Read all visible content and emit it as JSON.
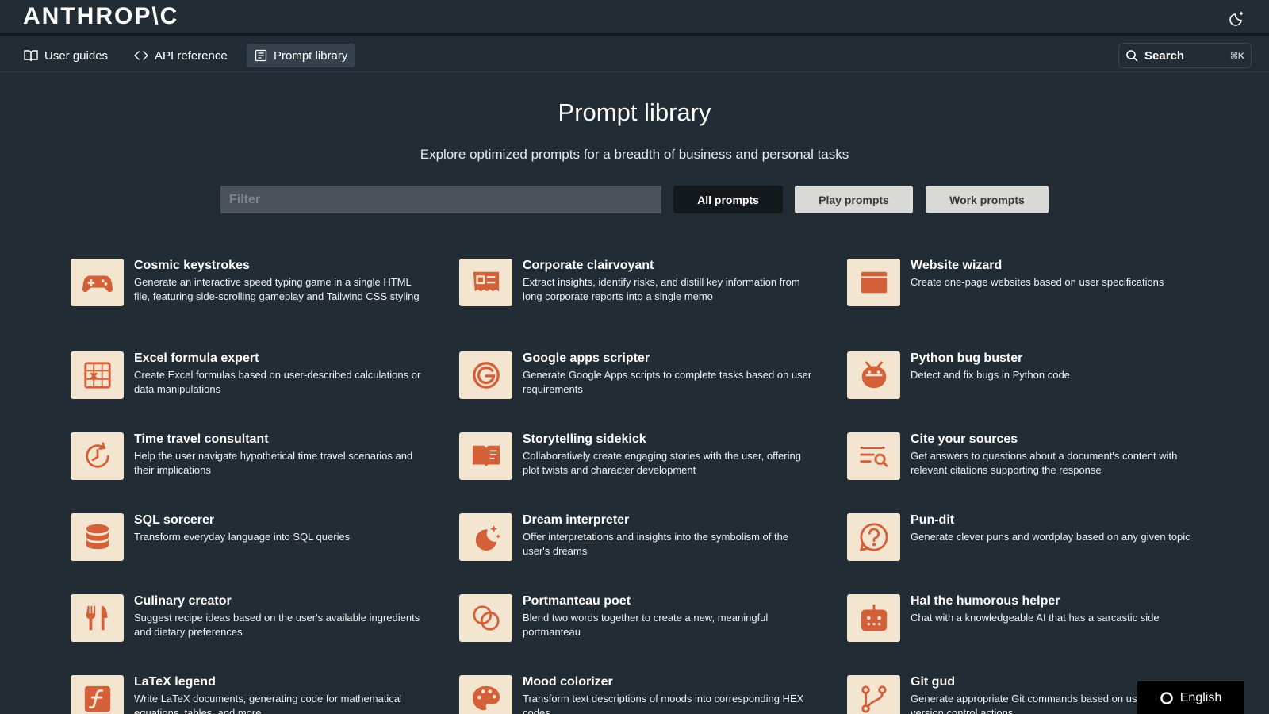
{
  "header": {
    "logo": "ANTHROP\\C",
    "theme_toggle_icon": "moon-sparkle-icon"
  },
  "nav": {
    "items": [
      {
        "label": "User guides",
        "icon": "book-icon"
      },
      {
        "label": "API reference",
        "icon": "code-brackets-icon"
      },
      {
        "label": "Prompt library",
        "icon": "library-icon"
      }
    ],
    "search": {
      "label": "Search",
      "shortcut": "⌘K"
    }
  },
  "hero": {
    "title": "Prompt library",
    "subtitle": "Explore optimized prompts for a breadth of business and personal tasks"
  },
  "filters": {
    "placeholder": "Filter",
    "all_label": "All prompts",
    "play_label": "Play prompts",
    "work_label": "Work prompts"
  },
  "cards": [
    {
      "title": "Cosmic keystrokes",
      "desc": "Generate an interactive speed typing game in a single HTML file, featuring side-scrolling gameplay and Tailwind CSS styling",
      "icon": "gamepad-icon"
    },
    {
      "title": "Corporate clairvoyant",
      "desc": "Extract insights, identify risks, and distill key information from long corporate reports into a single memo",
      "icon": "report-icon"
    },
    {
      "title": "Website wizard",
      "desc": "Create one-page websites based on user specifications",
      "icon": "browser-window-icon"
    },
    {
      "title": "Excel formula expert",
      "desc": "Create Excel formulas based on user-described calculations or data manipulations",
      "icon": "spreadsheet-icon"
    },
    {
      "title": "Google apps scripter",
      "desc": "Generate Google Apps scripts to complete tasks based on user requirements",
      "icon": "google-g-icon"
    },
    {
      "title": "Python bug buster",
      "desc": "Detect and fix bugs in Python code",
      "icon": "bug-icon"
    },
    {
      "title": "Time travel consultant",
      "desc": "Help the user navigate hypothetical time travel scenarios and their implications",
      "icon": "clock-rewind-icon"
    },
    {
      "title": "Storytelling sidekick",
      "desc": "Collaboratively create engaging stories with the user, offering plot twists and character development",
      "icon": "open-book-icon"
    },
    {
      "title": "Cite your sources",
      "desc": "Get answers to questions about a document's content with relevant citations supporting the response",
      "icon": "text-search-icon"
    },
    {
      "title": "SQL sorcerer",
      "desc": "Transform everyday language into SQL queries",
      "icon": "database-icon"
    },
    {
      "title": "Dream interpreter",
      "desc": "Offer interpretations and insights into the symbolism of the user's dreams",
      "icon": "moon-stars-icon"
    },
    {
      "title": "Pun-dit",
      "desc": "Generate clever puns and wordplay based on any given topic",
      "icon": "question-bubble-icon"
    },
    {
      "title": "Culinary creator",
      "desc": "Suggest recipe ideas based on the user's available ingredients and dietary preferences",
      "icon": "fork-knife-icon"
    },
    {
      "title": "Portmanteau poet",
      "desc": "Blend two words together to create a new, meaningful portmanteau",
      "icon": "overlapping-circles-icon"
    },
    {
      "title": "Hal the humorous helper",
      "desc": "Chat with a knowledgeable AI that has a sarcastic side",
      "icon": "robot-icon"
    },
    {
      "title": "LaTeX legend",
      "desc": "Write LaTeX documents, generating code for mathematical equations, tables, and more",
      "icon": "function-icon"
    },
    {
      "title": "Mood colorizer",
      "desc": "Transform text descriptions of moods into corresponding HEX codes",
      "icon": "palette-icon"
    },
    {
      "title": "Git gud",
      "desc": "Generate appropriate Git commands based on user-described version control actions",
      "icon": "git-branch-icon"
    }
  ],
  "colors": {
    "background": "#212c35",
    "icon_tile": "#f3e5cf",
    "icon_accent": "#d4603a"
  },
  "language": {
    "label": "English",
    "icon": "globe-circle-icon"
  }
}
